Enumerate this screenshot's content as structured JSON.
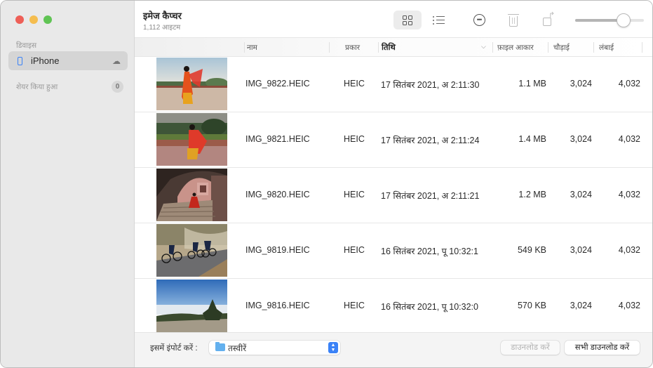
{
  "window": {
    "title": "इमेज कैप्चर",
    "item_count": "1,112 आइटम"
  },
  "sidebar": {
    "devices_label": "डिवाइस",
    "device": {
      "name": "iPhone",
      "icon": "iphone-icon",
      "status_icon": "cloud-icon"
    },
    "shared_label": "शेयर किया हुआ",
    "shared_count": "0"
  },
  "toolbar": {
    "grid_view_icon": "grid-icon",
    "list_view_icon": "list-icon",
    "more_icon": "ellipsis-circle-icon",
    "delete_icon": "trash-icon",
    "rotate_icon": "rotate-icon",
    "thumbnail_size_value": 0.75
  },
  "columns": {
    "name": "नाम",
    "type": "प्रकार",
    "date": "तिथि",
    "size": "फ़ाइल आकार",
    "width": "चौड़ाई",
    "height": "लंबाई"
  },
  "rows": [
    {
      "name": "IMG_9822.HEIC",
      "type": "HEIC",
      "date": "17 सितंबर 2021, अ 2:11:30",
      "size": "1.1 MB",
      "width": "3,024",
      "height": "4,032"
    },
    {
      "name": "IMG_9821.HEIC",
      "type": "HEIC",
      "date": "17 सितंबर 2021, अ 2:11:24",
      "size": "1.4 MB",
      "width": "3,024",
      "height": "4,032"
    },
    {
      "name": "IMG_9820.HEIC",
      "type": "HEIC",
      "date": "17 सितंबर 2021, अ 2:11:21",
      "size": "1.2 MB",
      "width": "3,024",
      "height": "4,032"
    },
    {
      "name": "IMG_9819.HEIC",
      "type": "HEIC",
      "date": "16 सितंबर 2021, पू 10:32:1",
      "size": "549 KB",
      "width": "3,024",
      "height": "4,032"
    },
    {
      "name": "IMG_9816.HEIC",
      "type": "HEIC",
      "date": "16 सितंबर 2021, पू 10:32:0",
      "size": "570 KB",
      "width": "3,024",
      "height": "4,032"
    }
  ],
  "footer": {
    "import_label": "इसमें इंपोर्ट करें :",
    "import_destination": "तस्वीरें",
    "download_button": "डाउनलोड करें",
    "download_all_button": "सभी डाउनलोड करें"
  }
}
